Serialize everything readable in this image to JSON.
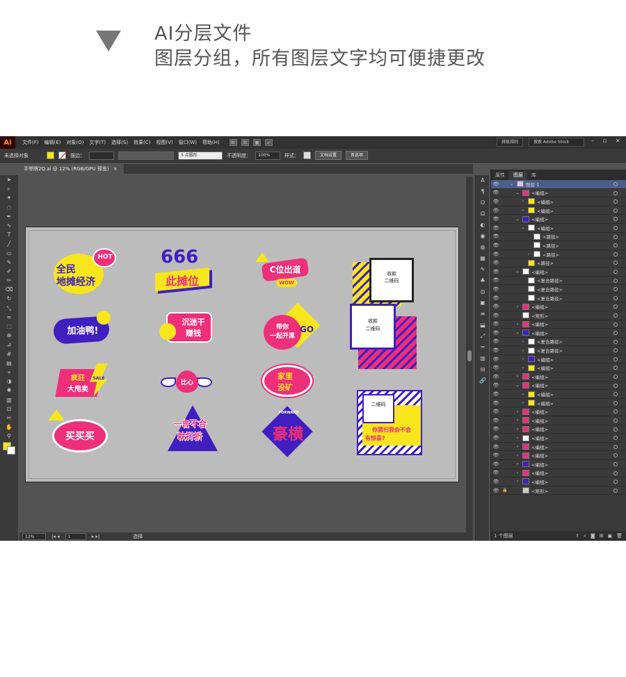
{
  "caption": {
    "line1": "AI分层文件",
    "line2": "图层分组，所有图层文字均可便捷更改"
  },
  "app": {
    "logo": "Ai",
    "menus": [
      "文件(F)",
      "编辑(E)",
      "对象(O)",
      "文字(T)",
      "选择(S)",
      "效果(C)",
      "视图(V)",
      "窗口(W)",
      "帮助(H)"
    ],
    "workspace": "排版规则",
    "search_placeholder": "搜索 Adobe Stock",
    "control": {
      "no_selection": "未选择对象",
      "stroke_label": "描边：",
      "brush_label": "5 点圆形",
      "opacity_label": "不透明度：",
      "opacity_value": "100%",
      "style_label": "样式：",
      "doc_setup": "文档设置",
      "preferences": "首选项"
    },
    "doc_tab": "手举牌2Q.ai @ 12% (RGB/GPU 预览)",
    "status": {
      "zoom": "12%",
      "page": "1",
      "tool": "选择"
    },
    "colors": {
      "yellow": "#f7e61c",
      "pink": "#ee2f7a",
      "purple": "#3f1fbf",
      "white": "#ffffff"
    }
  },
  "stickers": {
    "s1": {
      "line1": "全民",
      "line2": "地摊经济",
      "badge": "HOT"
    },
    "s2": {
      "line1": "666",
      "line2": "此摊位"
    },
    "s3": {
      "line1": "C位出道",
      "badge": "WOW"
    },
    "s4": {
      "line1": "加油鸭!"
    },
    "s5": {
      "line1": "沉迷干",
      "line2": "赚钱"
    },
    "s6": {
      "line1": "带你",
      "line2": "一起开黑",
      "badge": "GO"
    },
    "s7": {
      "line1": "疯狂",
      "line2": "大甩卖",
      "badge": "SALE"
    },
    "s8": {
      "line1": "比心"
    },
    "s9": {
      "line1": "家里",
      "line2": "没矿"
    },
    "s10": {
      "line1": "买买买"
    },
    "s11": {
      "line1": "一言不合",
      "line2": "就打折"
    },
    "s12": {
      "line1": "豪横",
      "badge": "FORWARD"
    },
    "qr1": {
      "top": "收款",
      "bottom": "二维码"
    },
    "qr2": {
      "top": "收款",
      "bottom": "二维码"
    },
    "qr3": {
      "top": "二维码",
      "line1": "你猜扫我会不会",
      "line2": "有惊喜?"
    }
  },
  "layers": {
    "tabs": [
      "属性",
      "图层",
      "库"
    ],
    "rows": [
      {
        "name": "图层 1",
        "indent": 0,
        "expanded": true
      },
      {
        "name": "<编组>",
        "indent": 1,
        "expanded": true
      },
      {
        "name": "<编组>",
        "indent": 2,
        "expanded": false
      },
      {
        "name": "<编组>",
        "indent": 2,
        "expanded": false
      },
      {
        "name": "<编组>",
        "indent": 1,
        "expanded": true
      },
      {
        "name": "<编组>",
        "indent": 2,
        "expanded": true
      },
      {
        "name": "<路径>",
        "indent": 3,
        "expanded": null
      },
      {
        "name": "<路径>",
        "indent": 3,
        "expanded": null
      },
      {
        "name": "<路径>",
        "indent": 3,
        "expanded": false
      },
      {
        "name": "<路径>",
        "indent": 2,
        "expanded": null
      },
      {
        "name": "<编组>",
        "indent": 1,
        "expanded": true
      },
      {
        "name": "<复合路径>",
        "indent": 2,
        "expanded": null
      },
      {
        "name": "<复合路径>",
        "indent": 2,
        "expanded": null
      },
      {
        "name": "<复合路径>",
        "indent": 2,
        "expanded": null
      },
      {
        "name": "<编组>",
        "indent": 1,
        "expanded": false
      },
      {
        "name": "<矩形>",
        "indent": 1,
        "expanded": null
      },
      {
        "name": "<编组>",
        "indent": 1,
        "expanded": false
      },
      {
        "name": "<编组>",
        "indent": 1,
        "expanded": true
      },
      {
        "name": "<复合路径>",
        "indent": 2,
        "expanded": false
      },
      {
        "name": "<复合路径>",
        "indent": 2,
        "expanded": false
      },
      {
        "name": "<编组>",
        "indent": 2,
        "expanded": false
      },
      {
        "name": "<编组>",
        "indent": 2,
        "expanded": false
      },
      {
        "name": "<编组>",
        "indent": 1,
        "expanded": false
      },
      {
        "name": "<编组>",
        "indent": 1,
        "expanded": true
      },
      {
        "name": "<编组>",
        "indent": 2,
        "expanded": false
      },
      {
        "name": "<编组>",
        "indent": 2,
        "expanded": false
      },
      {
        "name": "<编组>",
        "indent": 1,
        "expanded": false
      },
      {
        "name": "<编组>",
        "indent": 1,
        "expanded": false
      },
      {
        "name": "<编组>",
        "indent": 1,
        "expanded": false
      },
      {
        "name": "<编组>",
        "indent": 1,
        "expanded": false
      },
      {
        "name": "<编组>",
        "indent": 1,
        "expanded": false
      },
      {
        "name": "<编组>",
        "indent": 1,
        "expanded": false
      },
      {
        "name": "<编组>",
        "indent": 1,
        "expanded": false
      },
      {
        "name": "<编组>",
        "indent": 1,
        "expanded": false
      },
      {
        "name": "<编组>",
        "indent": 1,
        "expanded": false
      },
      {
        "name": "<矩形>",
        "indent": 1,
        "expanded": null
      }
    ],
    "footer": "1 个图层"
  }
}
